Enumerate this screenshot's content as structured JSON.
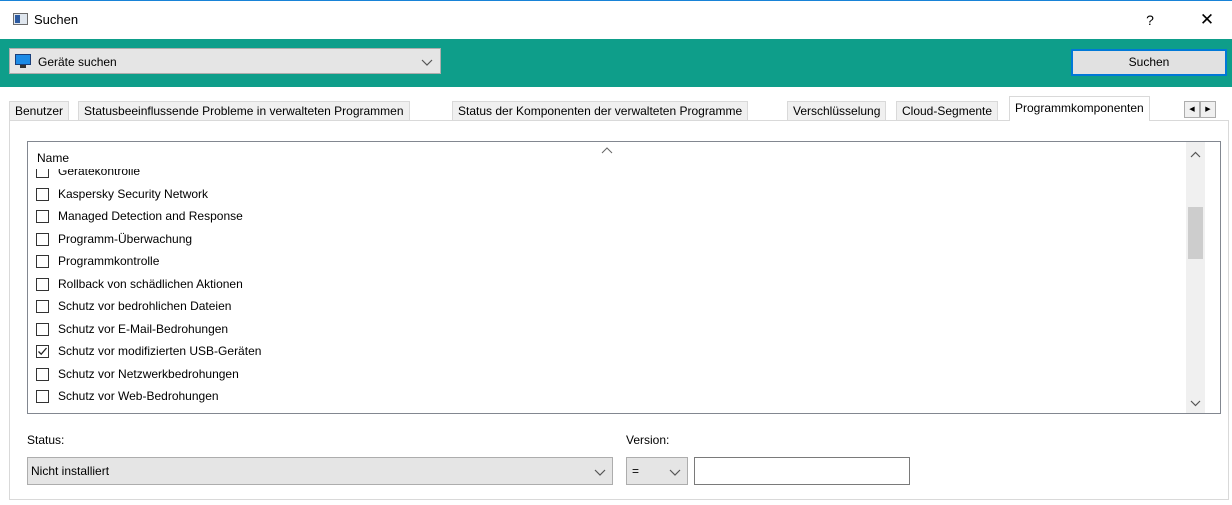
{
  "window": {
    "title": "Suchen",
    "help": "?",
    "close": "✕"
  },
  "toolbar": {
    "scope_value": "Geräte suchen",
    "search_label": "Suchen"
  },
  "tabs": [
    {
      "label": "Benutzer"
    },
    {
      "label": "Statusbeeinflussende Probleme in verwalteten Programmen"
    },
    {
      "label": "Status der Komponenten der verwalteten Programme"
    },
    {
      "label": "Verschlüsselung"
    },
    {
      "label": "Cloud-Segmente"
    },
    {
      "label": "Programmkomponenten",
      "active": true
    }
  ],
  "tab_scroll": {
    "left": "◀",
    "right": "▶"
  },
  "list": {
    "column_header": "Name",
    "items": [
      {
        "label": "Gerätekontrolle",
        "checked": false
      },
      {
        "label": "Kaspersky Security Network",
        "checked": false
      },
      {
        "label": "Managed Detection and Response",
        "checked": false
      },
      {
        "label": "Programm-Überwachung",
        "checked": false
      },
      {
        "label": "Programmkontrolle",
        "checked": false
      },
      {
        "label": "Rollback von schädlichen Aktionen",
        "checked": false
      },
      {
        "label": "Schutz vor bedrohlichen Dateien",
        "checked": false
      },
      {
        "label": "Schutz vor E-Mail-Bedrohungen",
        "checked": false
      },
      {
        "label": "Schutz vor modifizierten USB-Geräten",
        "checked": true
      },
      {
        "label": "Schutz vor Netzwerkbedrohungen",
        "checked": false
      },
      {
        "label": "Schutz vor Web-Bedrohungen",
        "checked": false
      }
    ]
  },
  "filters": {
    "status_label": "Status:",
    "status_value": "Nicht installiert",
    "version_label": "Version:",
    "version_operator": "=",
    "version_value": ""
  }
}
